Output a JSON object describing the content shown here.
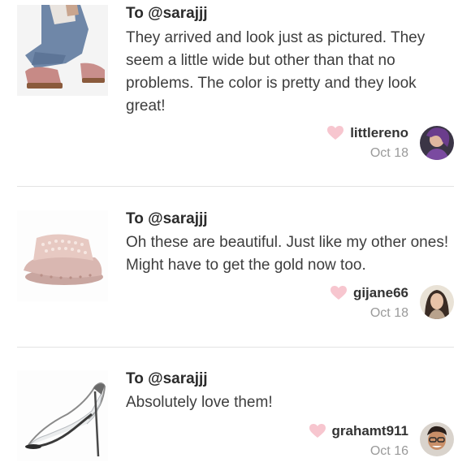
{
  "reviews": [
    {
      "to": "To @sarajjj",
      "text": "They arrived and look just as pictured. They seem a little wide but other than that no problems. The color is pretty and they look great!",
      "username": "littlereno",
      "date": "Oct 18",
      "product_icon": "velvet-slide-sandal-photo",
      "avatar_icon": "user-avatar-photo"
    },
    {
      "to": "To @sarajjj",
      "text": "Oh these are beautiful. Just like my other ones! Might have to get the gold now too.",
      "username": "gijane66",
      "date": "Oct 18",
      "product_icon": "rose-gold-embellished-slide-photo",
      "avatar_icon": "user-avatar-photo"
    },
    {
      "to": "To @sarajjj",
      "text": "Absolutely love them!",
      "username": "grahamt911",
      "date": "Oct 16",
      "product_icon": "clear-stiletto-pump-photo",
      "avatar_icon": "user-avatar-photo"
    }
  ],
  "colors": {
    "heart": "#f7c6cf",
    "divider": "#e3e3e3",
    "date_text": "#9a9a9a",
    "body_text": "#3d3d3d"
  }
}
